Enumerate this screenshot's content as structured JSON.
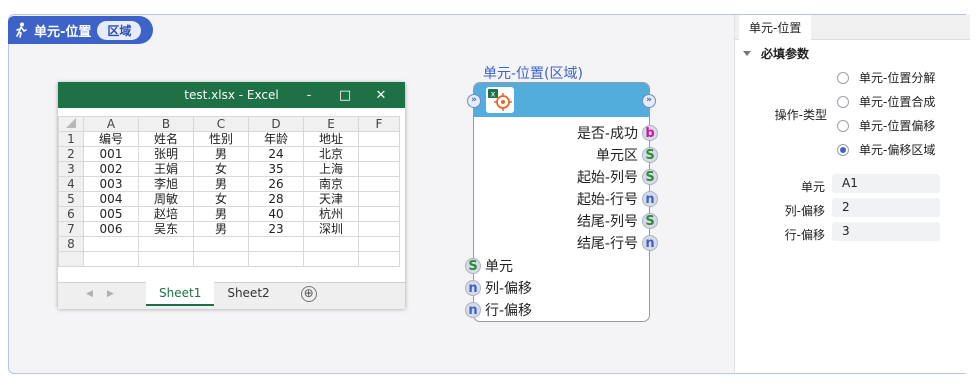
{
  "header": {
    "title": "单元-位置",
    "badge": "区域"
  },
  "excel": {
    "title": "test.xlsx  -  Excel",
    "controls": {
      "minimize": "-",
      "maximize": "□",
      "close": "✕"
    },
    "columns": [
      "A",
      "B",
      "C",
      "D",
      "E",
      "F"
    ],
    "rows": [
      {
        "n": "1",
        "cells": [
          "编号",
          "姓名",
          "性别",
          "年龄",
          "地址",
          ""
        ]
      },
      {
        "n": "2",
        "cells": [
          "001",
          "张明",
          "男",
          "24",
          "北京",
          ""
        ]
      },
      {
        "n": "3",
        "cells": [
          "002",
          "王娟",
          "女",
          "35",
          "上海",
          ""
        ]
      },
      {
        "n": "4",
        "cells": [
          "003",
          "李旭",
          "男",
          "26",
          "南京",
          ""
        ]
      },
      {
        "n": "5",
        "cells": [
          "004",
          "周敏",
          "女",
          "28",
          "天津",
          ""
        ]
      },
      {
        "n": "6",
        "cells": [
          "005",
          "赵培",
          "男",
          "40",
          "杭州",
          ""
        ]
      },
      {
        "n": "7",
        "cells": [
          "006",
          "吴东",
          "男",
          "23",
          "深圳",
          ""
        ]
      },
      {
        "n": "8",
        "cells": [
          "",
          "",
          "",
          "",
          "",
          ""
        ]
      }
    ],
    "sheets": [
      "Sheet1",
      "Sheet2"
    ],
    "add_sheet": "⊕"
  },
  "node": {
    "title": "单元-位置(区域)",
    "outputs": [
      {
        "label": "是否-成功",
        "type": "b"
      },
      {
        "label": "单元区",
        "type": "S"
      },
      {
        "label": "起始-列号",
        "type": "S"
      },
      {
        "label": "起始-行号",
        "type": "n"
      },
      {
        "label": "结尾-列号",
        "type": "S"
      },
      {
        "label": "结尾-行号",
        "type": "n"
      }
    ],
    "inputs": [
      {
        "label": "单元",
        "type": "S"
      },
      {
        "label": "列-偏移",
        "type": "n"
      },
      {
        "label": "行-偏移",
        "type": "n"
      }
    ]
  },
  "panel": {
    "tab": "单元-位置",
    "section": "必填参数",
    "op_label": "操作-类型",
    "options": [
      "单元-位置分解",
      "单元-位置合成",
      "单元-位置偏移",
      "单元-偏移区域"
    ],
    "selected_option": "单元-偏移区域",
    "fields": [
      {
        "label": "单元",
        "value": "A1"
      },
      {
        "label": "列-偏移",
        "value": "2"
      },
      {
        "label": "行-偏移",
        "value": "3"
      }
    ]
  },
  "colors": {
    "accent": "#3e63c8",
    "excel_green": "#1e7145",
    "node_header": "#52acdc"
  }
}
